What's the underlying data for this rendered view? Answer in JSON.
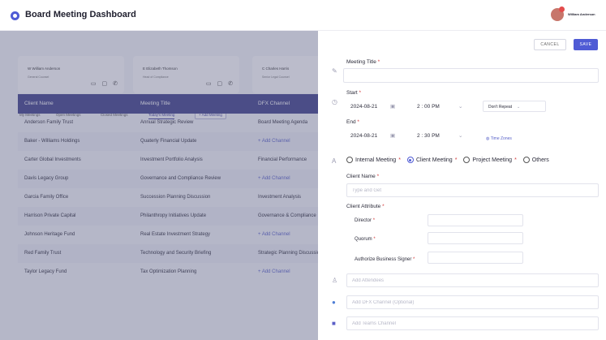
{
  "app": {
    "title": "Board Meeting Dashboard",
    "user_name": "William Anderson"
  },
  "cards": [
    {
      "name": "W  William Anderson",
      "sub": "General Counsel"
    },
    {
      "name": "E  Elizabeth Thomson",
      "sub": "Head of Compliance"
    },
    {
      "name": "C  Charles Harris",
      "sub": "Senior Legal Counsel"
    }
  ],
  "tabs": {
    "items": [
      "My Meetings",
      "Open Meetings",
      "Closed Meetings",
      "Today's Meeting"
    ],
    "add_meeting_label": "+ Add Meeting"
  },
  "table": {
    "headers": [
      "Client Name",
      "Meeting Title",
      "DFX Channel"
    ],
    "rows": [
      [
        "Anderson Family Trust",
        "Annual Strategic Review",
        "Board Meeting Agenda"
      ],
      [
        "Baker - Williams Holdings",
        "Quaterly Financial Update",
        "+ Add Channel"
      ],
      [
        "Carter Global Investments",
        "Investment Portfolio Analysis",
        "Financial Performance"
      ],
      [
        "Davis Legacy Group",
        "Governance and Compliance Review",
        "+ Add Channel"
      ],
      [
        "Garcia Family Office",
        "Succession Planning Discussion",
        "Investment Analysis"
      ],
      [
        "Harrison Private Capital",
        "Philanthropy Initiatives Update",
        "Governance & Compliance"
      ],
      [
        "Johnson Heritage Fund",
        "Real Estate Investment Strategy",
        "+ Add Channel"
      ],
      [
        "Red Family Trust",
        "Technology and Security Briefing",
        "Strategic Planning Discussion"
      ],
      [
        "Taylor Legacy Fund",
        "Tax Optimization Planning",
        "+ Add Channel"
      ]
    ]
  },
  "form": {
    "cancel_label": "CANCEL",
    "save_label": "SAVE",
    "meeting_title_label": "Meeting Title",
    "start_label": "Start",
    "start_date": "2024-08-21",
    "start_time": "2 : 00 PM",
    "repeat": "Don't Repeat",
    "end_label": "End",
    "end_date": "2024-08-21",
    "end_time": "2 : 30 PM",
    "timezone_label": "Time Zones",
    "required_mark": "*",
    "meeting_types": [
      {
        "label": "Internal Meeting",
        "selected": false
      },
      {
        "label": "Client Meeting",
        "selected": true
      },
      {
        "label": "Project Meeting",
        "selected": false
      },
      {
        "label": "Others",
        "selected": false
      }
    ],
    "client_name_label": "Client Name",
    "client_name_placeholder": "Type and Get",
    "client_attribute_label": "Client Attribute",
    "director_label": "Director",
    "quorum_label": "Quorum",
    "business_signer_label": "Authorize Business Signer",
    "attendees_placeholder": "Add Attendees",
    "dfx_channel_placeholder": "Add DFX Channel (Optional)",
    "teams_channel_placeholder": "Add Teams Channel"
  }
}
